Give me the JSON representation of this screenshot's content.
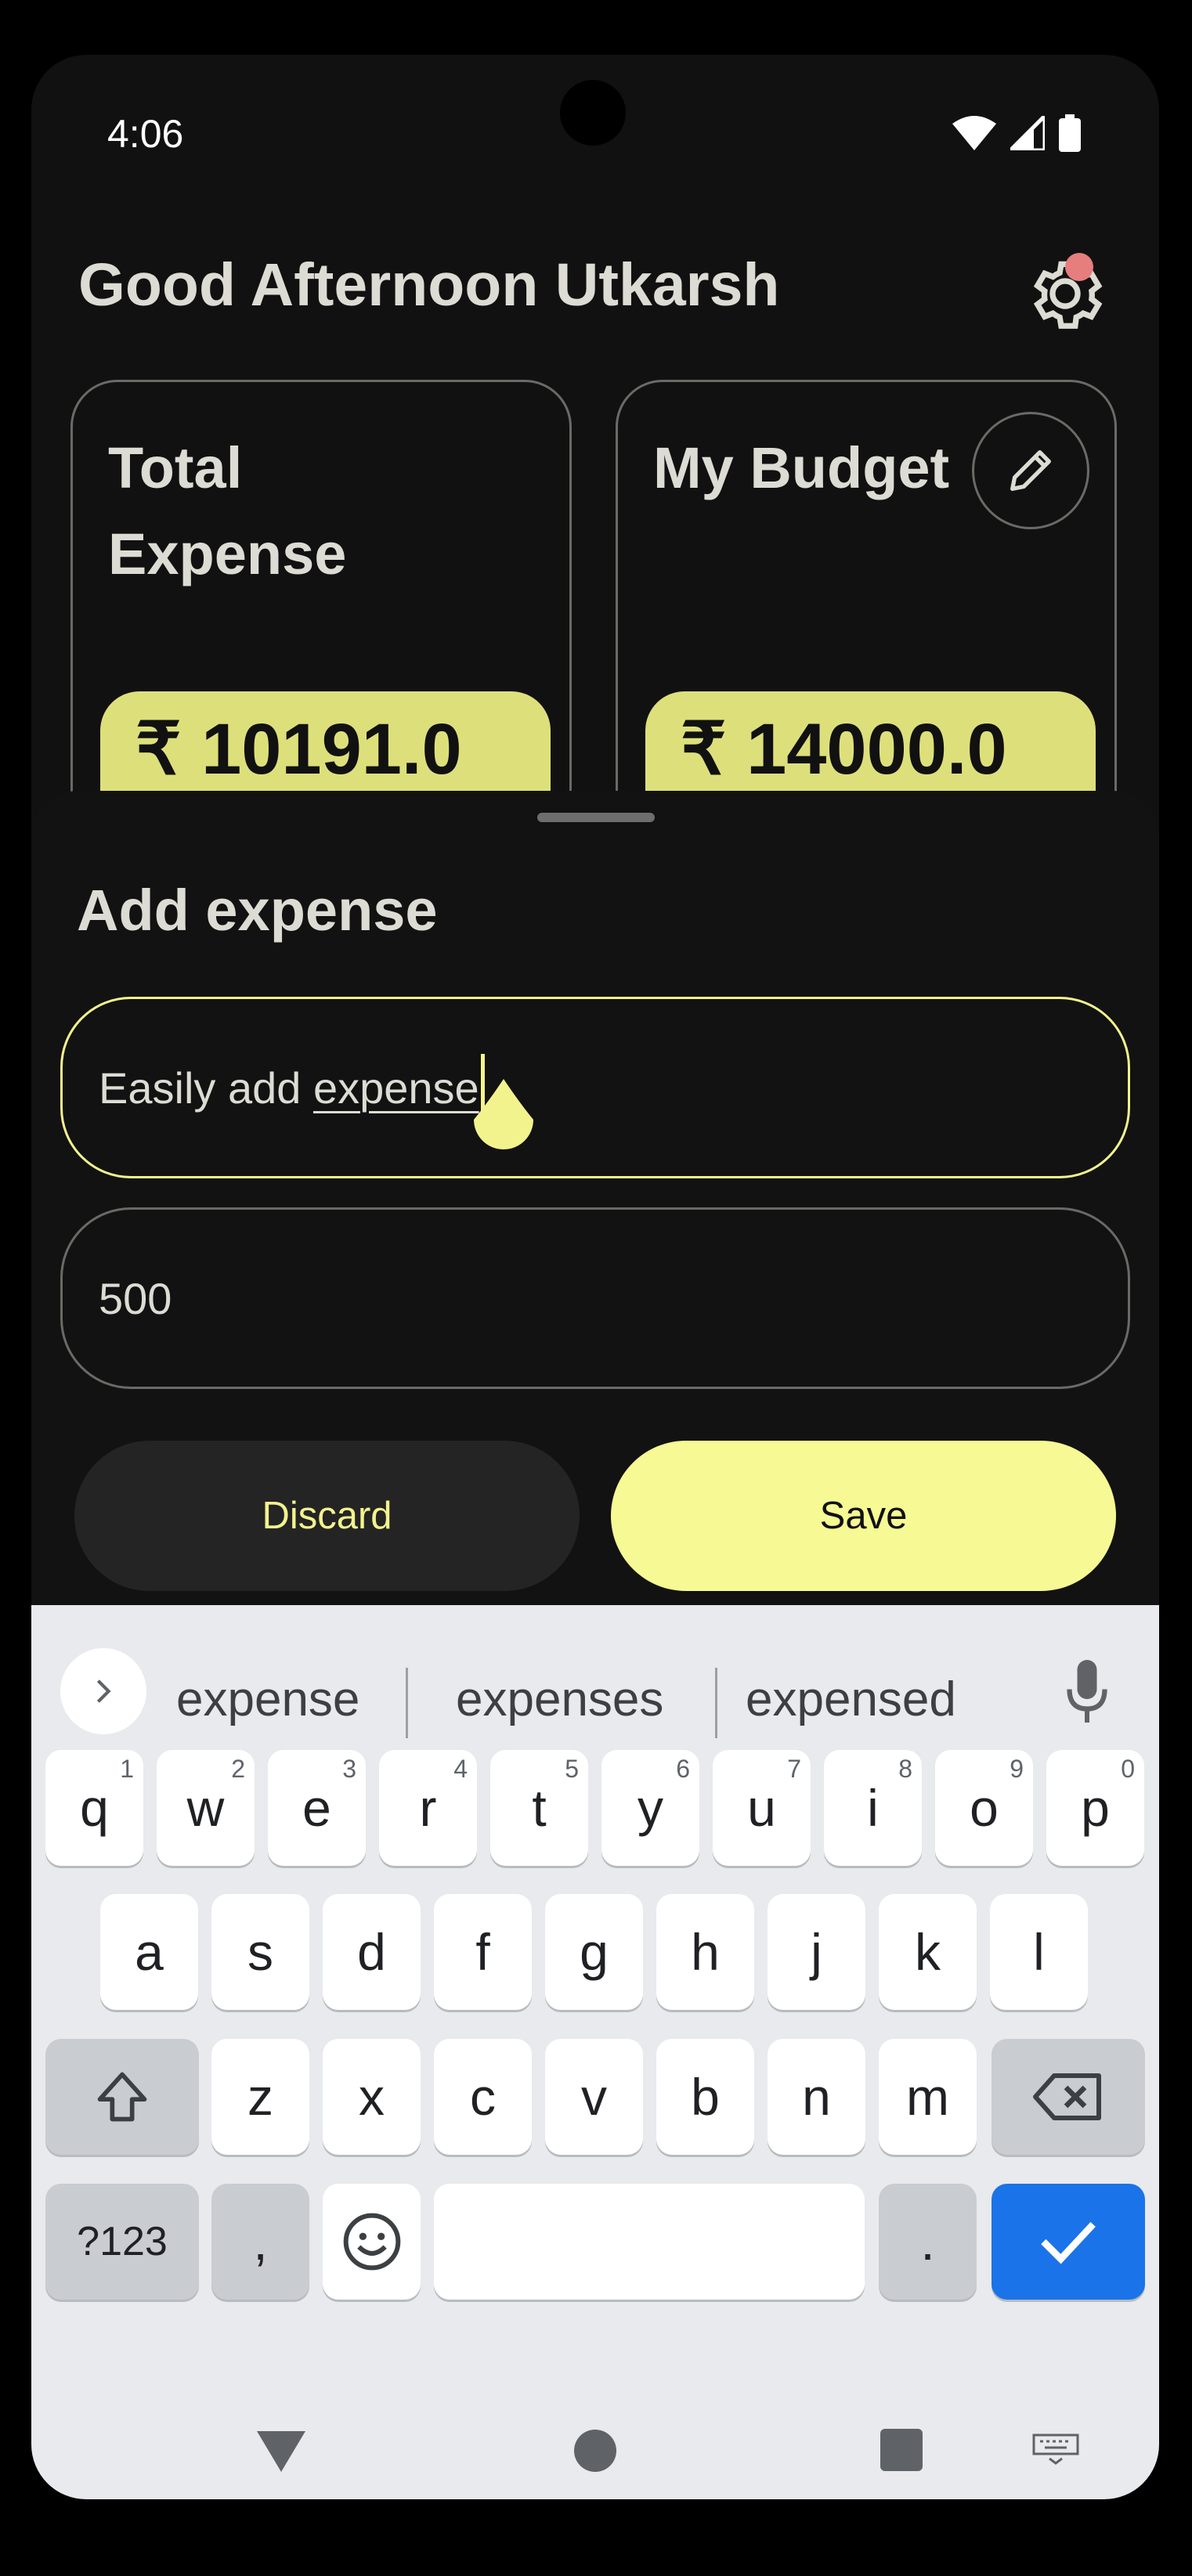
{
  "status_bar": {
    "time": "4:06"
  },
  "header": {
    "greeting": "Good Afternoon Utkarsh",
    "settings_icon": "gear-icon"
  },
  "cards": [
    {
      "title": "Total Expense",
      "amount": "₹ 10191.0"
    },
    {
      "title": "My Budget",
      "amount": "₹ 14000.0",
      "action_icon": "pencil-icon"
    }
  ],
  "sheet": {
    "title": "Add expense",
    "description_prefix": "Easily add ",
    "description_word": "expense",
    "amount_value": "500",
    "discard_label": "Discard",
    "save_label": "Save"
  },
  "keyboard": {
    "suggestions": [
      "expense",
      "expenses",
      "expensed"
    ],
    "row1": [
      {
        "k": "q",
        "n": "1"
      },
      {
        "k": "w",
        "n": "2"
      },
      {
        "k": "e",
        "n": "3"
      },
      {
        "k": "r",
        "n": "4"
      },
      {
        "k": "t",
        "n": "5"
      },
      {
        "k": "y",
        "n": "6"
      },
      {
        "k": "u",
        "n": "7"
      },
      {
        "k": "i",
        "n": "8"
      },
      {
        "k": "o",
        "n": "9"
      },
      {
        "k": "p",
        "n": "0"
      }
    ],
    "row2": [
      "a",
      "s",
      "d",
      "f",
      "g",
      "h",
      "j",
      "k",
      "l"
    ],
    "row3": [
      "z",
      "x",
      "c",
      "v",
      "b",
      "n",
      "m"
    ],
    "symbols_label": "?123",
    "comma": ",",
    "period": "."
  },
  "colors": {
    "accent": "#f7f994",
    "card_amount_bg": "#dde07a",
    "background": "#111111",
    "keyboard_action": "#1a73e8"
  }
}
